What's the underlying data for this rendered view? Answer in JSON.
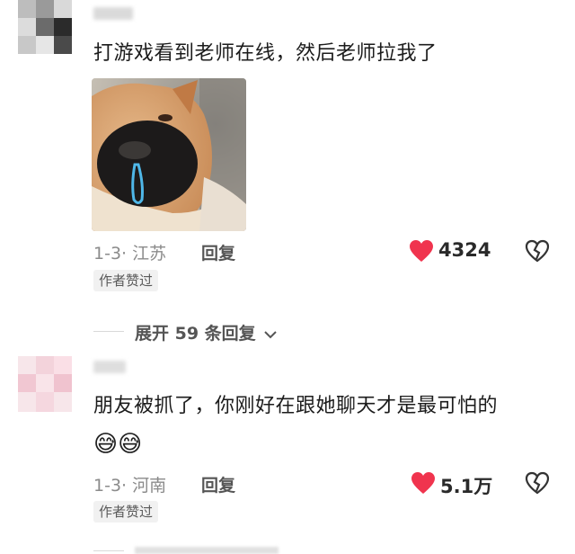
{
  "comments": [
    {
      "text": "打游戏看到老师在线，然后老师拉我了",
      "date": "1-3",
      "location": "江苏",
      "reply_label": "回复",
      "likes": "4324",
      "badge": "作者赞过",
      "has_image": true,
      "image_icon": "shiba-dog-meme"
    },
    {
      "text": "朋友被抓了，你刚好在跟她聊天才是最可怕的",
      "emojis": "😅😅",
      "date": "1-3",
      "location": "河南",
      "reply_label": "回复",
      "likes": "5.1万",
      "badge": "作者赞过",
      "has_image": false
    }
  ],
  "expand_replies": {
    "label": "展开 59 条回复"
  },
  "colors": {
    "heart": "#f0344e",
    "text": "#1c1c1c",
    "meta": "#8b8b8b",
    "badge_bg": "#f1f1f1"
  },
  "icons": {
    "like": "heart-icon",
    "dislike": "broken-heart-icon",
    "expand": "chevron-down-icon"
  }
}
